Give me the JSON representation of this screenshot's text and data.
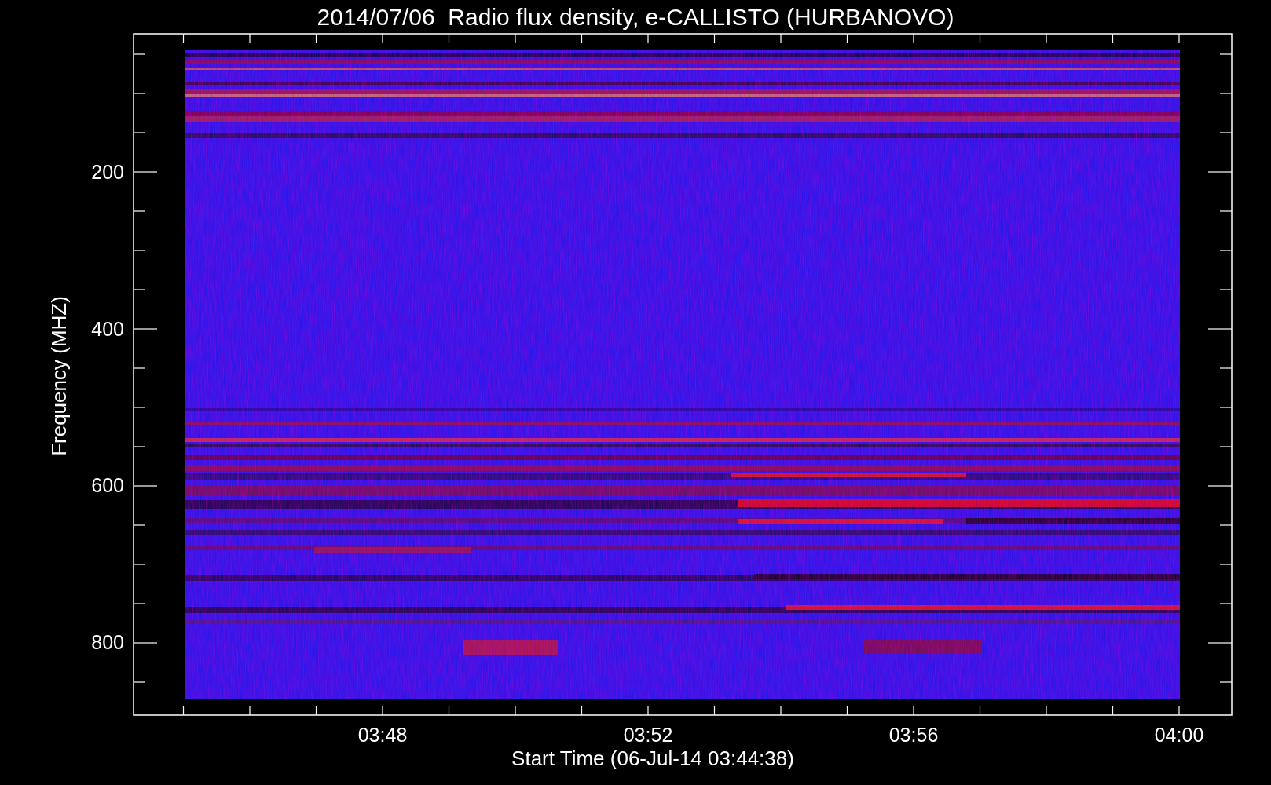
{
  "title": "2014/07/06  Radio flux density, e-CALLISTO (HURBANOVO)",
  "y_axis": {
    "label": "Frequency (MHZ)",
    "ticks": [
      "200",
      "400",
      "600",
      "800"
    ]
  },
  "x_axis": {
    "label": "Start Time (06-Jul-14 03:44:38)",
    "ticks": [
      "03:48",
      "03:52",
      "03:56",
      "04:00"
    ]
  }
}
